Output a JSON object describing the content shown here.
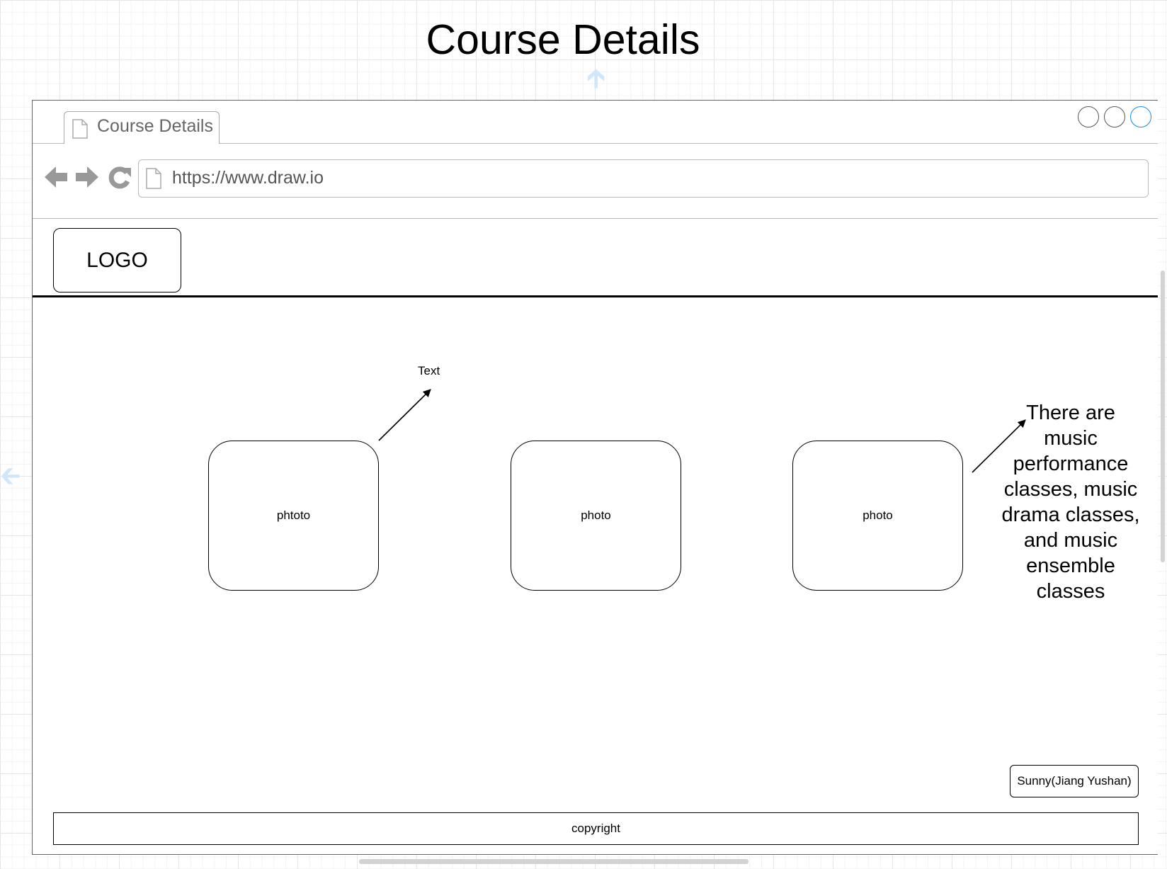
{
  "diagram_title": "Course Details",
  "browser": {
    "tab_title": "Course Details",
    "url": "https://www.draw.io"
  },
  "header": {
    "logo_label": "LOGO"
  },
  "content": {
    "photos": [
      "phtoto",
      "photo",
      "photo"
    ],
    "callout_text": "Text",
    "description": "There are music performance classes, music drama classes, and music ensemble classes"
  },
  "author_tag": "Sunny(Jiang Yushan)",
  "footer": {
    "label": "copyright"
  },
  "icons": [
    "page-icon",
    "back-arrow-icon",
    "forward-arrow-icon",
    "reload-icon",
    "window-button-icons"
  ],
  "colors": {
    "accent": "#1a8bdc",
    "canvas_hint": "#cfe6fb"
  }
}
